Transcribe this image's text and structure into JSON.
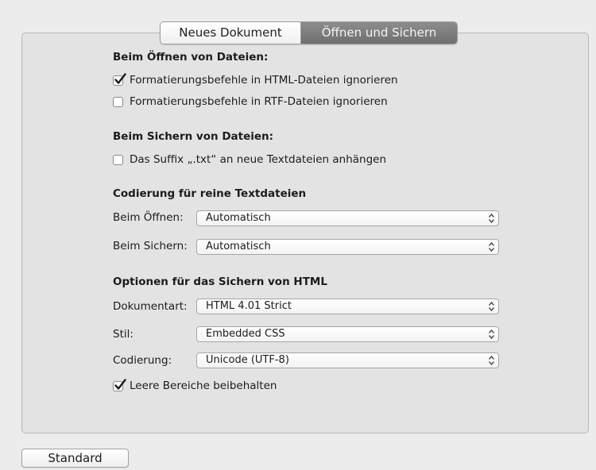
{
  "tabs": [
    {
      "label": "Neues Dokument",
      "selected": false
    },
    {
      "label": "Öffnen und Sichern",
      "selected": true
    }
  ],
  "open_files": {
    "heading": "Beim Öffnen von Dateien:",
    "ignore_html": {
      "label": "Formatierungsbefehle in HTML-Dateien ignorieren",
      "checked": true
    },
    "ignore_rtf": {
      "label": "Formatierungsbefehle in RTF-Dateien ignorieren",
      "checked": false
    }
  },
  "save_files": {
    "heading": "Beim Sichern von Dateien:",
    "append_suffix": {
      "label": "Das Suffix „.txt“ an neue Textdateien anhängen",
      "checked": false
    }
  },
  "encoding": {
    "heading": "Codierung für reine Textdateien",
    "open_label": "Beim Öffnen:",
    "open_value": "Automatisch",
    "save_label": "Beim Sichern:",
    "save_value": "Automatisch"
  },
  "html_options": {
    "heading": "Optionen für das Sichern von HTML",
    "doctype_label": "Dokumentart:",
    "doctype_value": "HTML 4.01 Strict",
    "style_label": "Stil:",
    "style_value": "Embedded CSS",
    "encoding_label": "Codierung:",
    "encoding_value": "Unicode (UTF-8)",
    "preserve_whitespace": {
      "label": "Leere Bereiche beibehalten",
      "checked": true
    }
  },
  "footer": {
    "default_button": "Standard"
  }
}
